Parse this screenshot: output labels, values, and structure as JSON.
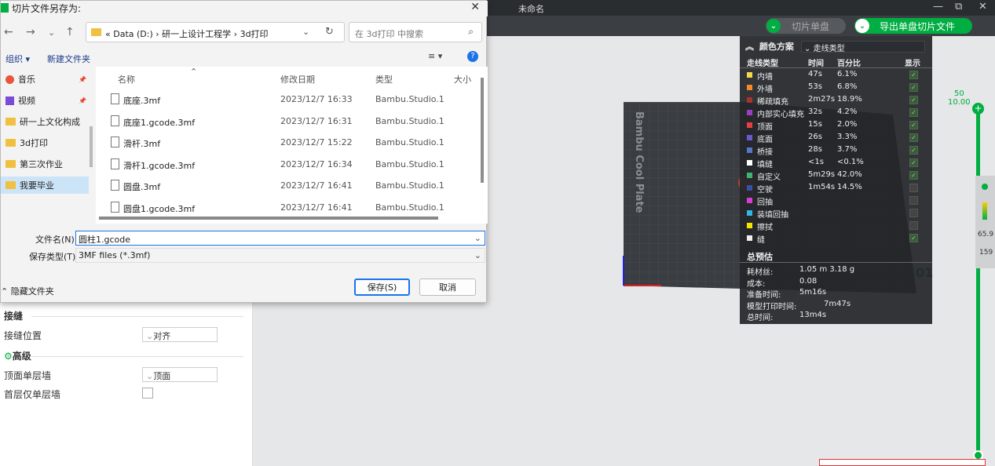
{
  "app": {
    "window_title": "未命名",
    "toolbar": {
      "slice_plate": "切片单盘",
      "export_sliced": "导出单盘切片文件"
    }
  },
  "dialog": {
    "title": "切片文件另存为:",
    "close": "✕",
    "nav": {
      "back": "←",
      "forward": "→",
      "down": "⌄",
      "up": "↑"
    },
    "breadcrumb": {
      "prefix": "«",
      "drive": "Data (D:)",
      "sep1": "›",
      "folder1": "研一上设计工程学",
      "sep2": "›",
      "folder2": "3d打印"
    },
    "search_placeholder": "在 3d打印 中搜索",
    "cmd": {
      "organize": "组织 ▾",
      "new_folder": "新建文件夹"
    },
    "sidebar": [
      {
        "label": "音乐",
        "pin": "📌"
      },
      {
        "label": "视频",
        "pin": "📌"
      },
      {
        "label": "研一上文化构成"
      },
      {
        "label": "3d打印"
      },
      {
        "label": "第三次作业"
      },
      {
        "label": "我要毕业"
      }
    ],
    "columns": {
      "name": "名称",
      "date": "修改日期",
      "type": "类型",
      "size": "大小"
    },
    "files": [
      {
        "name": "底座.3mf",
        "date": "2023/12/7 16:33",
        "type": "Bambu.Studio.1"
      },
      {
        "name": "底座1.gcode.3mf",
        "date": "2023/12/7 16:31",
        "type": "Bambu.Studio.1"
      },
      {
        "name": "滑杆.3mf",
        "date": "2023/12/7 15:22",
        "type": "Bambu.Studio.1"
      },
      {
        "name": "滑杆1.gcode.3mf",
        "date": "2023/12/7 16:34",
        "type": "Bambu.Studio.1"
      },
      {
        "name": "圆盘.3mf",
        "date": "2023/12/7 16:41",
        "type": "Bambu.Studio.1"
      },
      {
        "name": "圆盘1.gcode.3mf",
        "date": "2023/12/7 16:41",
        "type": "Bambu.Studio.1"
      }
    ],
    "filename_label": "文件名(N):",
    "filename_value": "圆柱1.gcode",
    "filetype_label": "保存类型(T):",
    "filetype_value": "3MF files (*.3mf)",
    "hide_folders": "隐藏文件夹",
    "save": "保存(S)",
    "cancel": "取消"
  },
  "left_panel": {
    "seam_header": "接缝",
    "seam_position_label": "接缝位置",
    "seam_position_value": "对齐",
    "advanced_header": "高级",
    "top_single_wall_label": "顶面单层墙",
    "top_single_wall_value": "顶面",
    "first_layer_single_wall_label": "首层仅单层墙"
  },
  "legend": {
    "scheme_label": "颜色方案",
    "scheme_value": "走线类型",
    "col_type": "走线类型",
    "col_time": "时间",
    "col_pct": "百分比",
    "col_show": "显示",
    "rows": [
      {
        "name": "内墙",
        "time": "47s",
        "pct": "6.1%",
        "color": "#f6d94a",
        "shown": true
      },
      {
        "name": "外墙",
        "time": "53s",
        "pct": "6.8%",
        "color": "#f08a2a",
        "shown": true
      },
      {
        "name": "稀疏填充",
        "time": "2m27s",
        "pct": "18.9%",
        "color": "#a83232",
        "shown": true
      },
      {
        "name": "内部实心填充",
        "time": "32s",
        "pct": "4.2%",
        "color": "#9b3fc2",
        "shown": true
      },
      {
        "name": "顶面",
        "time": "15s",
        "pct": "2.0%",
        "color": "#e34040",
        "shown": true
      },
      {
        "name": "底面",
        "time": "26s",
        "pct": "3.3%",
        "color": "#6a5acd",
        "shown": true
      },
      {
        "name": "桥接",
        "time": "28s",
        "pct": "3.7%",
        "color": "#5a76c8",
        "shown": true
      },
      {
        "name": "填缝",
        "time": "<1s",
        "pct": "<0.1%",
        "color": "#ffffff",
        "shown": true
      },
      {
        "name": "自定义",
        "time": "5m29s",
        "pct": "42.0%",
        "color": "#3cb371",
        "shown": true
      },
      {
        "name": "空驶",
        "time": "1m54s",
        "pct": "14.5%",
        "color": "#3a4fa8",
        "shown": false
      },
      {
        "name": "回抽",
        "time": "",
        "pct": "",
        "color": "#d63cd6",
        "shown": false
      },
      {
        "name": "装填回抽",
        "time": "",
        "pct": "",
        "color": "#33b5e5",
        "shown": false
      },
      {
        "name": "擦拭",
        "time": "",
        "pct": "",
        "color": "#f5e600",
        "shown": false
      },
      {
        "name": "缝",
        "time": "",
        "pct": "",
        "color": "#eeeeee",
        "shown": true
      }
    ],
    "summary_title": "总预估",
    "summary": [
      {
        "label": "耗材丝:",
        "value": "1.05 m   3.18 g"
      },
      {
        "label": "成本:",
        "value": "0.08"
      },
      {
        "label": "准备时间:",
        "value": "5m16s"
      },
      {
        "label": "模型打印时间:",
        "value": "7m47s"
      },
      {
        "label": "总时间:",
        "value": "13m4s"
      }
    ]
  },
  "plate": {
    "label": "Bambu Cool Plate",
    "number": "01"
  },
  "layer_slider": {
    "top_layer": "50",
    "top_height": "10.00",
    "side_a": "65.9",
    "side_b": "159"
  }
}
